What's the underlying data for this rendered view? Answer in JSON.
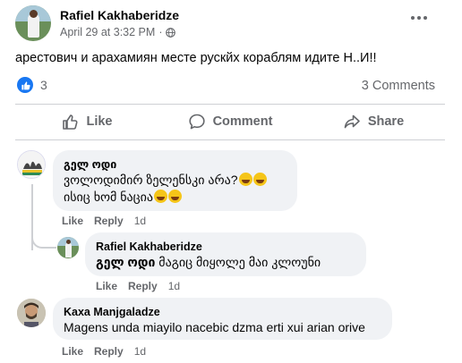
{
  "post": {
    "author": "Rafiel Kakhaberidze",
    "date": "April 29 at 3:32 PM",
    "separator": "·",
    "text": "арестович и арахамиян месте рускйх кораблям идите Н..И!!",
    "like_count": "3",
    "comments_label": "3 Comments"
  },
  "actions": {
    "like": "Like",
    "comment": "Comment",
    "share": "Share"
  },
  "comments": [
    {
      "author": "გელ ოდი",
      "line1": "ვოლოდიმირ ზელენსკი არა?",
      "line2": "ისიც ხომ ნაცია",
      "like": "Like",
      "reply": "Reply",
      "time": "1d"
    },
    {
      "author": "Rafiel Kakhaberidze",
      "mention": "გელ ოდი",
      "text": "მაგიც მიყოლე მაი კლოუნი",
      "like": "Like",
      "reply": "Reply",
      "time": "1d"
    },
    {
      "author": "Kaxa Manjgaladze",
      "text": "Magens unda miayilo nacebic dzma erti xui arian orive",
      "like": "Like",
      "reply": "Reply",
      "time": "1d"
    }
  ],
  "colors": {
    "brand_blue": "#1877f2",
    "secondary_text": "#65676b",
    "bubble_bg": "#f0f2f5"
  }
}
